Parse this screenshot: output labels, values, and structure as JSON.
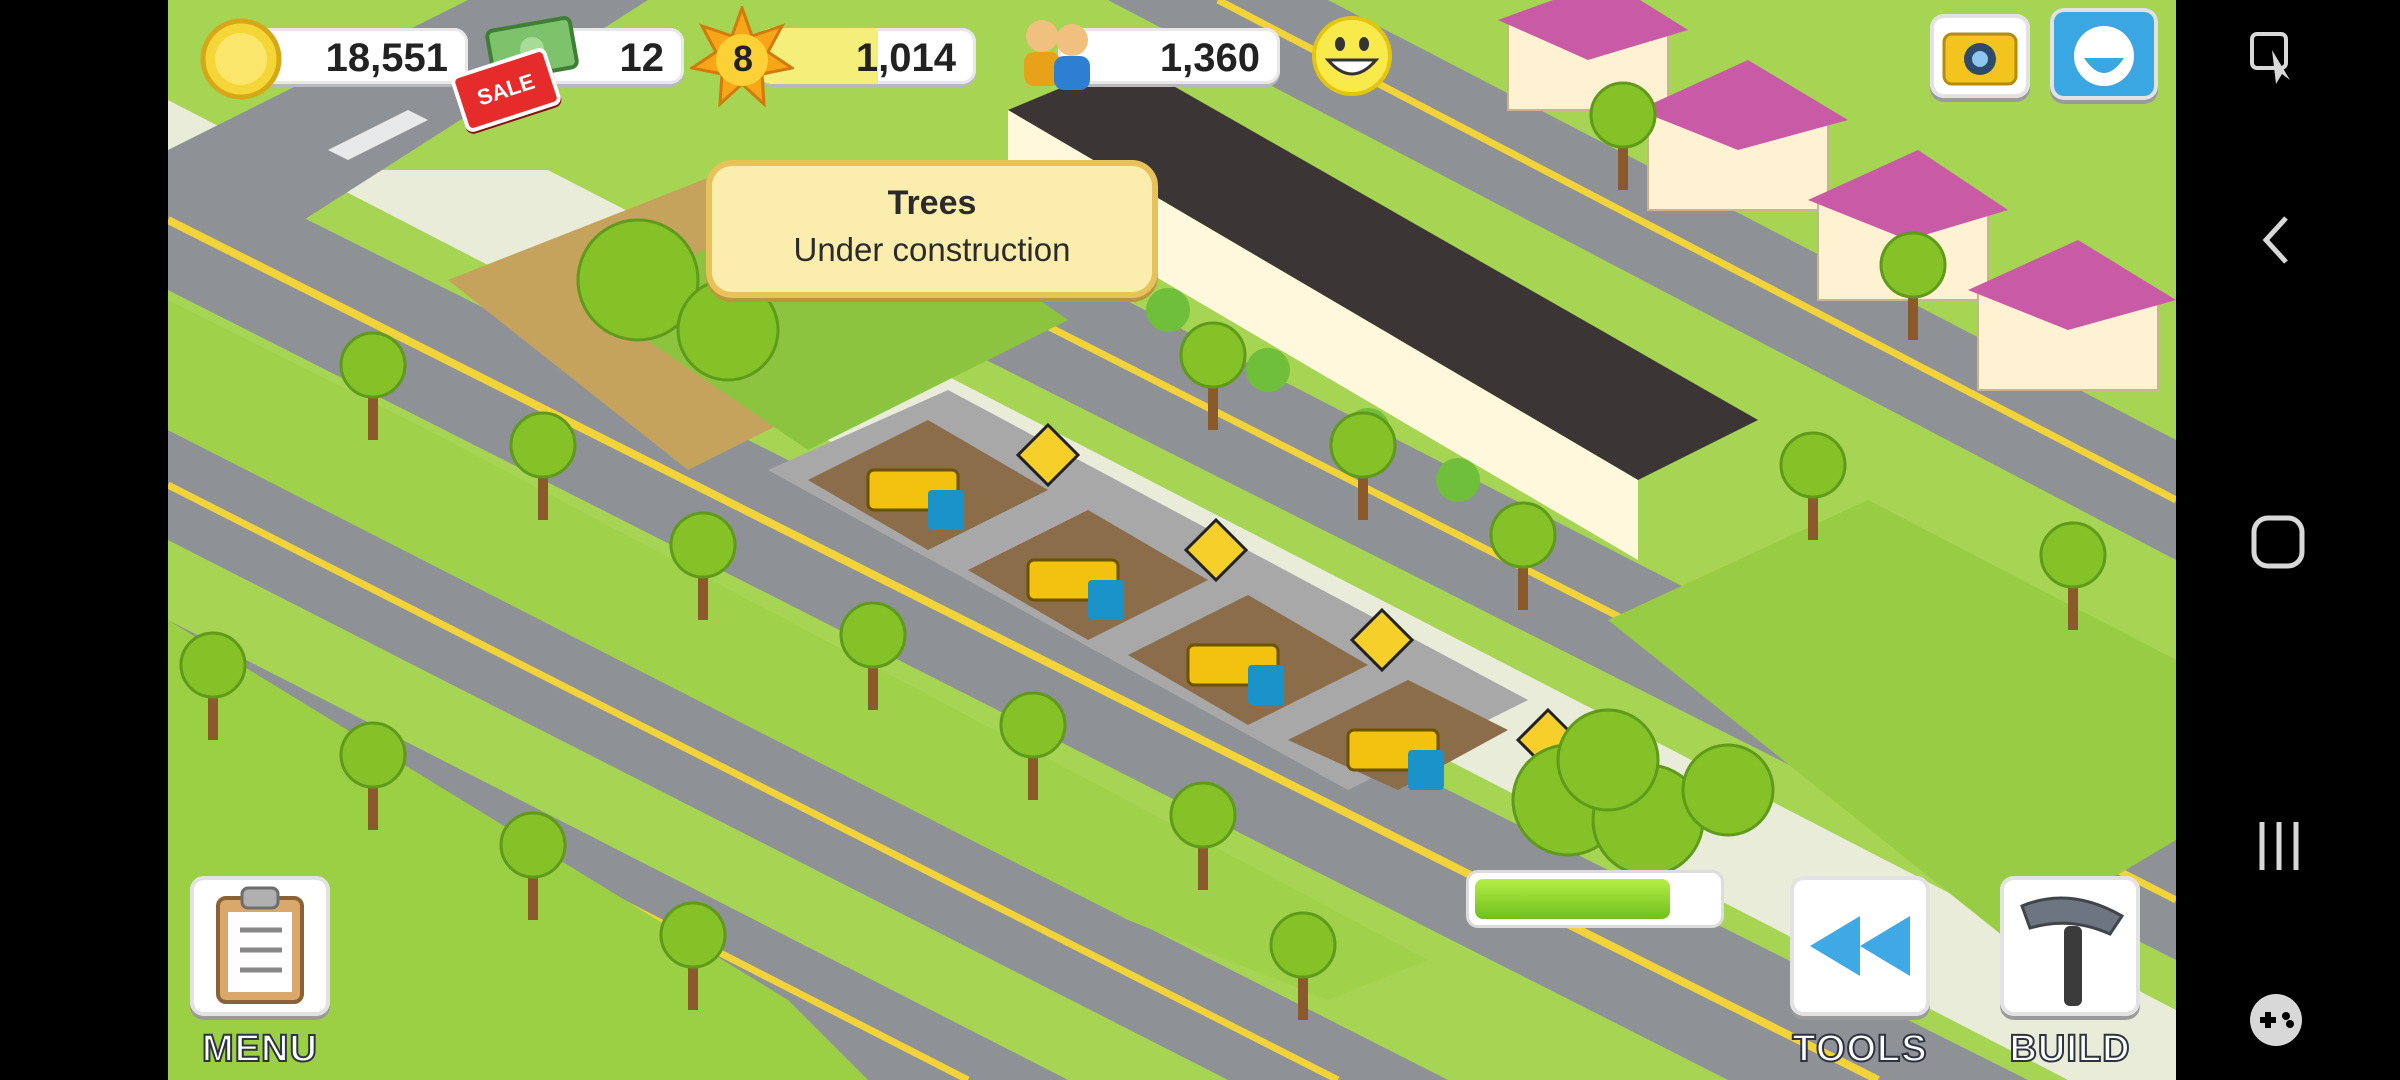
{
  "hud": {
    "coins": "18,551",
    "cash": "12",
    "sale_badge": "SALE",
    "level": "8",
    "xp": "1,014",
    "xp_progress": 0.55,
    "population": "1,360"
  },
  "tooltip": {
    "title": "Trees",
    "subtitle": "Under construction"
  },
  "construction_progress": 0.82,
  "buttons": {
    "menu_label": "MENU",
    "tools_label": "TOOLS",
    "build_label": "BUILD"
  },
  "icons": {
    "coin": "coin-icon",
    "cash": "cash-icon",
    "level": "star-level-icon",
    "population": "population-icon",
    "happiness": "smiley-icon",
    "camera": "camera-icon",
    "share": "share-icon",
    "menu": "clipboard-icon",
    "tools": "rewind-icon",
    "build": "hammer-icon"
  },
  "colors": {
    "grass": "#9ccb4a",
    "road": "#8e9296",
    "tooltip_bg": "#fbedae",
    "progress_fill": "#8fd62c"
  }
}
